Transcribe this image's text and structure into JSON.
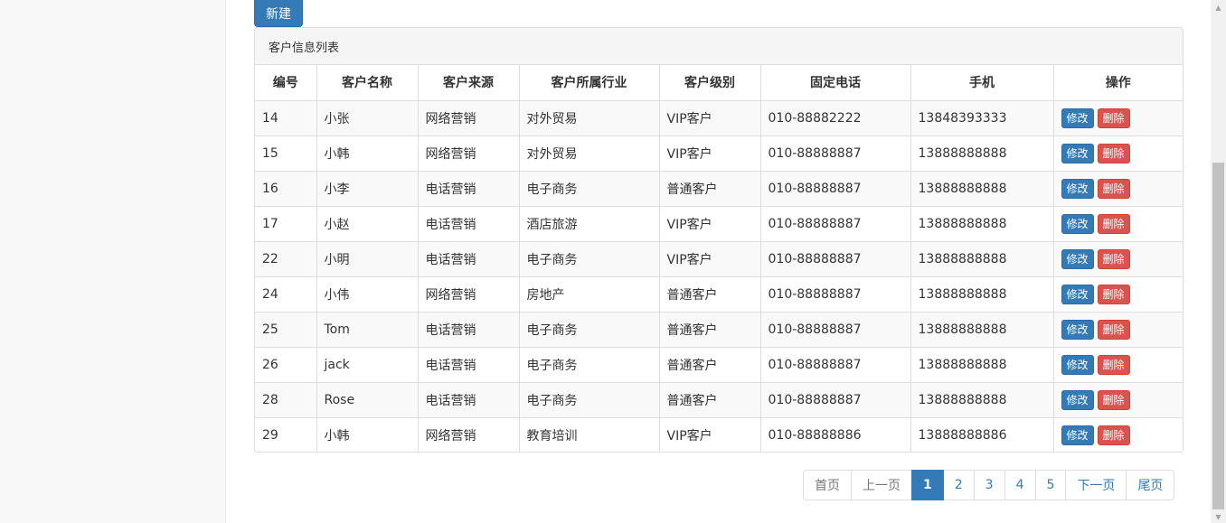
{
  "toolbar": {
    "new_label": "新建"
  },
  "panel": {
    "title": "客户信息列表"
  },
  "table": {
    "headers": [
      "编号",
      "客户名称",
      "客户来源",
      "客户所属行业",
      "客户级别",
      "固定电话",
      "手机",
      "操作"
    ],
    "edit_label": "修改",
    "delete_label": "删除",
    "rows": [
      [
        "14",
        "小张",
        "网络营销",
        "对外贸易",
        "VIP客户",
        "010-88882222",
        "13848393333"
      ],
      [
        "15",
        "小韩",
        "网络营销",
        "对外贸易",
        "VIP客户",
        "010-88888887",
        "13888888888"
      ],
      [
        "16",
        "小李",
        "电话营销",
        "电子商务",
        "普通客户",
        "010-88888887",
        "13888888888"
      ],
      [
        "17",
        "小赵",
        "电话营销",
        "酒店旅游",
        "VIP客户",
        "010-88888887",
        "13888888888"
      ],
      [
        "22",
        "小明",
        "电话营销",
        "电子商务",
        "VIP客户",
        "010-88888887",
        "13888888888"
      ],
      [
        "24",
        "小伟",
        "网络营销",
        "房地产",
        "普通客户",
        "010-88888887",
        "13888888888"
      ],
      [
        "25",
        "Tom",
        "电话营销",
        "电子商务",
        "普通客户",
        "010-88888887",
        "13888888888"
      ],
      [
        "26",
        "jack",
        "电话营销",
        "电子商务",
        "普通客户",
        "010-88888887",
        "13888888888"
      ],
      [
        "28",
        "Rose",
        "电话营销",
        "电子商务",
        "普通客户",
        "010-88888887",
        "13888888888"
      ],
      [
        "29",
        "小韩",
        "网络营销",
        "教育培训",
        "VIP客户",
        "010-88888886",
        "13888888886"
      ]
    ]
  },
  "pagination": {
    "first": "首页",
    "prev": "上一页",
    "pages": [
      "1",
      "2",
      "3",
      "4",
      "5"
    ],
    "active_page": "1",
    "next": "下一页",
    "last": "尾页"
  },
  "colors": {
    "primary": "#337ab7",
    "danger": "#d9534f"
  },
  "icons": {
    "scroll_up": "scroll-up-arrow-icon",
    "scroll_down": "scroll-down-arrow-icon"
  }
}
